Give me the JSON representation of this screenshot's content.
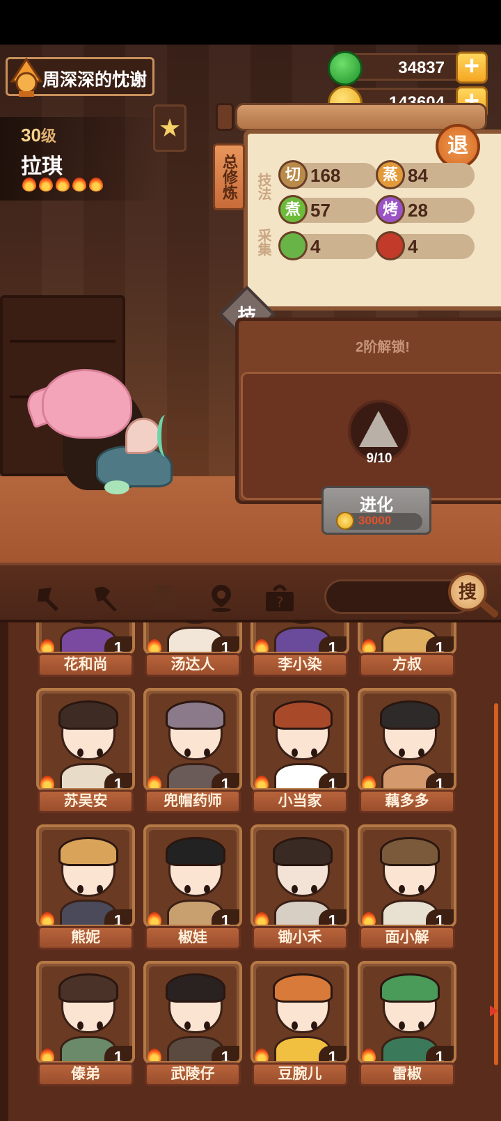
{
  "player": {
    "name": "周深深的忱谢"
  },
  "currency": {
    "jade": {
      "value": "34837",
      "plus": "+",
      "icon": "jade-coin-icon"
    },
    "gold": {
      "value": "143604",
      "plus": "+",
      "icon": "gold-coin-icon"
    }
  },
  "character": {
    "level_number": "30",
    "level_unit": "级",
    "name": "拉琪",
    "flames": 5
  },
  "skill_panel": {
    "tab_label": "总修炼",
    "technique_label": "技法",
    "gather_label": "采集",
    "retreat_label": "退",
    "skill_button_label": "技",
    "stats": [
      {
        "icon_char": "切",
        "value": "168",
        "color": "#b98b4a"
      },
      {
        "icon_char": "蒸",
        "value": "84",
        "color": "#e29a3a"
      },
      {
        "icon_char": "煮",
        "value": "57",
        "color": "#6dbb3a"
      },
      {
        "icon_char": "烤",
        "value": "28",
        "color": "#9a54c6"
      },
      {
        "icon_char": "",
        "icon": "cabbage-icon",
        "value": "4",
        "color": "#69b447"
      },
      {
        "icon_char": "",
        "icon": "meat-icon",
        "value": "4",
        "color": "#c23a2a"
      }
    ]
  },
  "evolution": {
    "unlock_text": "2阶解锁!",
    "progress_text": "9/10",
    "progress_fraction": 0.9,
    "button_label": "进化",
    "cost": "30000"
  },
  "filter_bar": {
    "icons": [
      "pin-tool-icon",
      "spatula-icon",
      "jar-icon",
      "location-icon",
      "mystery-box-icon"
    ],
    "search_label": "搜"
  },
  "cards": [
    {
      "name": "花和尚",
      "count": "1",
      "hair": "#f3d7cf",
      "body": "#7a4aa0",
      "skin": "#fbe4d2"
    },
    {
      "name": "汤达人",
      "count": "1",
      "hair": "#3a2a20",
      "body": "#f2e6d8",
      "skin": "#fbe4d2"
    },
    {
      "name": "李小染",
      "count": "1",
      "hair": "#3a2a20",
      "body": "#6a4a9a",
      "skin": "#fbe4d2"
    },
    {
      "name": "方叔",
      "count": "1",
      "hair": "#f2cdbb",
      "body": "#e0b060",
      "skin": "#f6d0bb"
    },
    {
      "name": "苏吴安",
      "count": "1",
      "hair": "#3e2c24",
      "body": "#e8dcc8",
      "skin": "#fbe4d2"
    },
    {
      "name": "兜帽药师",
      "count": "1",
      "hair": "#8a7a8a",
      "body": "#6a5a58",
      "skin": "#fbe4d2"
    },
    {
      "name": "小当家",
      "count": "1",
      "hair": "#a84a2a",
      "body": "#ffffff",
      "skin": "#fbe4d2"
    },
    {
      "name": "藕多多",
      "count": "1",
      "hair": "#2e2a2a",
      "body": "#d49a6e",
      "skin": "#fbe4d2"
    },
    {
      "name": "熊妮",
      "count": "1",
      "hair": "#d9a45a",
      "body": "#4a4a5a",
      "skin": "#fbe4d2"
    },
    {
      "name": "椒娃",
      "count": "1",
      "hair": "#222222",
      "body": "#c8a070",
      "skin": "#fbe4d2"
    },
    {
      "name": "锄小禾",
      "count": "1",
      "hair": "#3a2a24",
      "body": "#d8cfc4",
      "skin": "#f3e2d6"
    },
    {
      "name": "面小解",
      "count": "1",
      "hair": "#7a5a3a",
      "body": "#e8e0d0",
      "skin": "#fbe4d2"
    },
    {
      "name": "傣弟",
      "count": "1",
      "hair": "#4a3228",
      "body": "#6a8a6a",
      "skin": "#fbe4d2"
    },
    {
      "name": "武陵仔",
      "count": "1",
      "hair": "#2a2220",
      "body": "#5a4a40",
      "skin": "#fbe4d2"
    },
    {
      "name": "豆腕儿",
      "count": "1",
      "hair": "#d87a3a",
      "body": "#f2c040",
      "skin": "#fbe4d2"
    },
    {
      "name": "雷椒",
      "count": "1",
      "hair": "#4a9a5a",
      "body": "#3a7a5a",
      "skin": "#fbe4d2"
    }
  ]
}
